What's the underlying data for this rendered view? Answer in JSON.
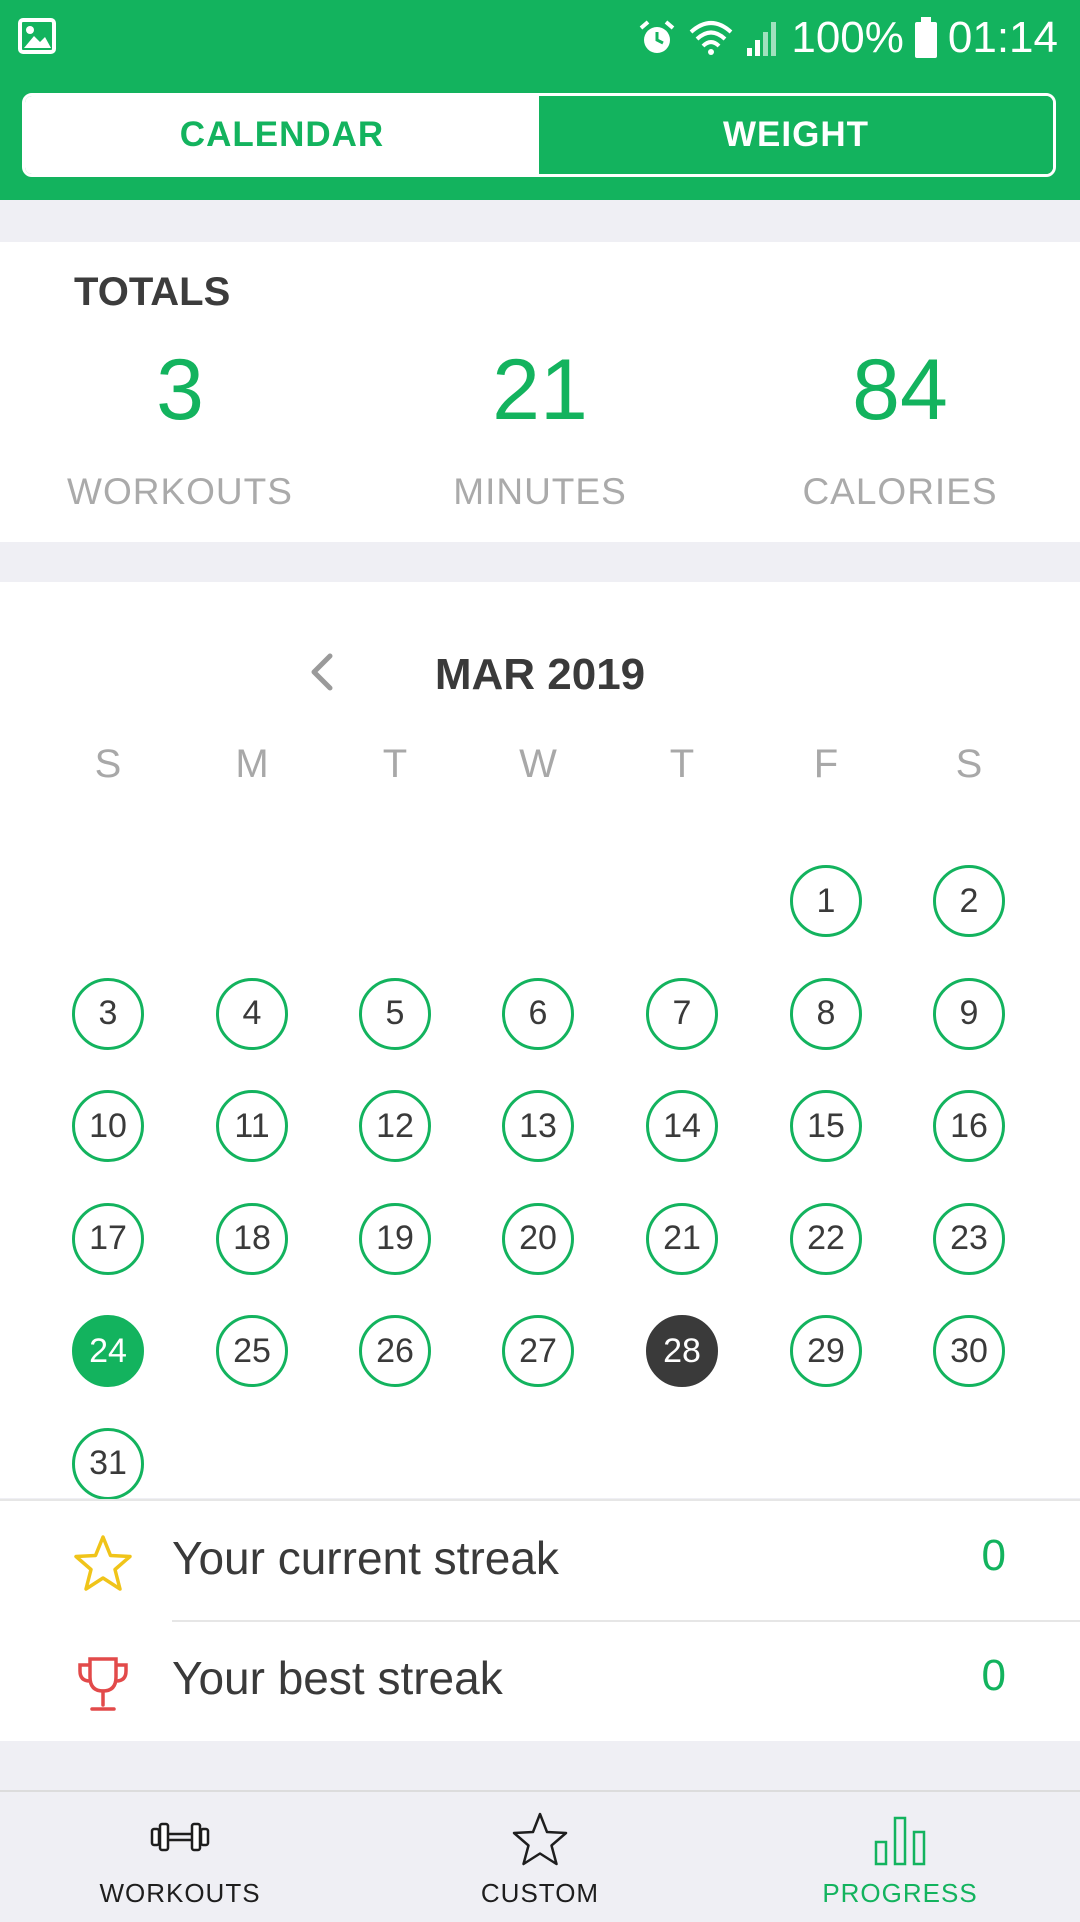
{
  "status_bar": {
    "battery": "100%",
    "time": "01:14",
    "icons": [
      "gallery-icon",
      "alarm-icon",
      "wifi-icon",
      "signal-icon",
      "battery-icon"
    ]
  },
  "tabs": [
    {
      "label": "CALENDAR",
      "active": true
    },
    {
      "label": "WEIGHT",
      "active": false
    }
  ],
  "totals": {
    "title": "TOTALS",
    "workouts": {
      "value": "3",
      "label": "WORKOUTS"
    },
    "minutes": {
      "value": "21",
      "label": "MINUTES"
    },
    "calories": {
      "value": "84",
      "label": "CALORIES"
    }
  },
  "calendar": {
    "month": "MAR 2019",
    "weekdays": [
      "S",
      "M",
      "T",
      "W",
      "T",
      "F",
      "S"
    ],
    "first_weekday_index": 5,
    "days_in_month": 31,
    "selected_day": 24,
    "today": 28
  },
  "streaks": {
    "current": {
      "label": "Your current streak",
      "value": "0"
    },
    "best": {
      "label": "Your best streak",
      "value": "0"
    }
  },
  "bottom_nav": [
    {
      "label": "WORKOUTS",
      "icon": "dumbbell-icon",
      "active": false
    },
    {
      "label": "CUSTOM",
      "icon": "star-outline-icon",
      "active": false
    },
    {
      "label": "PROGRESS",
      "icon": "bar-chart-icon",
      "active": true
    }
  ],
  "colors": {
    "accent": "#13b35e",
    "today": "#3a3a3a",
    "star": "#f0c419",
    "trophy": "#e24a4a"
  }
}
